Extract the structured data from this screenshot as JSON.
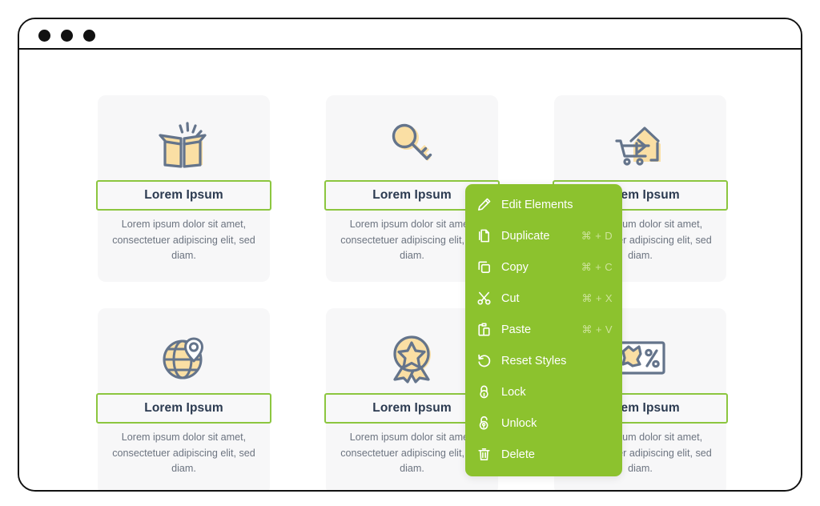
{
  "window": {
    "controls": [
      {
        "name": "window-dot-1"
      },
      {
        "name": "window-dot-2"
      },
      {
        "name": "window-dot-3"
      }
    ]
  },
  "colors": {
    "accent_green": "#8cc22e",
    "border_green": "#8cc63f",
    "icon_outline": "#64748b",
    "icon_fill": "#fadfa4",
    "title_text": "#2b3a50",
    "body_text": "#6c7480",
    "card_bg": "#f7f7f8",
    "shortcut_text": "#cde39a"
  },
  "cards": [
    {
      "icon": "open-box-icon",
      "title": "Lorem Ipsum",
      "desc": "Lorem ipsum dolor sit amet, consectetuer adipiscing elit, sed diam."
    },
    {
      "icon": "key-icon",
      "title": "Lorem Ipsum",
      "desc": "Lorem ipsum dolor sit amet, consectetuer adipiscing elit, sed diam."
    },
    {
      "icon": "house-cart-delivery-icon",
      "title": "Lorem Ipsum",
      "desc": "Lorem ipsum dolor sit amet, consectetuer adipiscing elit, sed diam."
    },
    {
      "icon": "globe-location-pin-icon",
      "title": "Lorem Ipsum",
      "desc": "Lorem ipsum dolor sit amet, consectetuer adipiscing elit, sed diam."
    },
    {
      "icon": "award-star-badge-icon",
      "title": "Lorem Ipsum",
      "desc": "Lorem ipsum dolor sit amet, consectetuer adipiscing elit, sed diam."
    },
    {
      "icon": "discount-percent-tag-icon",
      "title": "Lorem Ipsum",
      "desc": "Lorem ipsum dolor sit amet, consectetuer adipiscing elit, sed diam."
    }
  ],
  "context_menu": {
    "items": [
      {
        "icon": "pencil-icon",
        "label": "Edit Elements",
        "shortcut": ""
      },
      {
        "icon": "duplicate-icon",
        "label": "Duplicate",
        "shortcut": "⌘ + D"
      },
      {
        "icon": "copy-icon",
        "label": "Copy",
        "shortcut": "⌘ + C"
      },
      {
        "icon": "scissors-icon",
        "label": "Cut",
        "shortcut": "⌘ + X"
      },
      {
        "icon": "clipboard-icon",
        "label": "Paste",
        "shortcut": "⌘ + V"
      },
      {
        "icon": "undo-arrow-icon",
        "label": "Reset Styles",
        "shortcut": ""
      },
      {
        "icon": "lock-icon",
        "label": "Lock",
        "shortcut": ""
      },
      {
        "icon": "unlock-icon",
        "label": "Unlock",
        "shortcut": ""
      },
      {
        "icon": "trash-icon",
        "label": "Delete",
        "shortcut": ""
      }
    ]
  }
}
